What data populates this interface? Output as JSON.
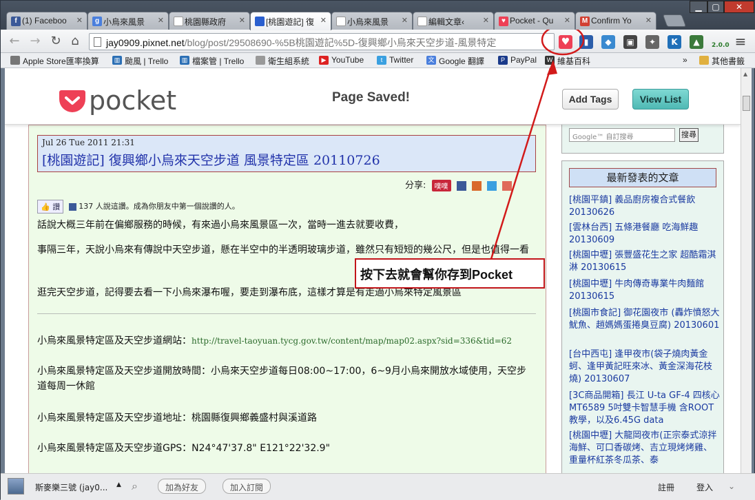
{
  "tabs": [
    {
      "label": "(1) Faceboo",
      "fav": "f",
      "favColor": "#3b5998"
    },
    {
      "label": "小烏來風景",
      "fav": "g",
      "favColor": "#4a7fdd"
    },
    {
      "label": "桃園縣政府",
      "fav": "",
      "favColor": "#ffffff"
    },
    {
      "label": "[桃園遊記] 復",
      "fav": "",
      "favColor": "#2a5fcf"
    },
    {
      "label": "小烏來風景",
      "fav": "",
      "favColor": "#ffffff"
    },
    {
      "label": "編輯文章‹",
      "fav": "",
      "favColor": "#ffffff"
    },
    {
      "label": "Pocket - Qu",
      "fav": "♥",
      "favColor": "#ee4056"
    },
    {
      "label": "Confirm Yo",
      "fav": "M",
      "favColor": "#d23f31"
    }
  ],
  "toolbar": {
    "url_host": "jay0909.pixnet.net",
    "url_path": "/blog/post/29508690-%5B桃園遊記%5D-復興鄉小烏來天空步道-風景特定",
    "extension_badge": "2.0.0"
  },
  "bookmarks": [
    {
      "label": "Apple Store匯率換算",
      "color": "#777"
    },
    {
      "label": "颱風 | Trello",
      "color": "#2b6fb5"
    },
    {
      "label": "檔案管 | Trello",
      "color": "#2b6fb5"
    },
    {
      "label": "衛生組系統",
      "color": "#999"
    },
    {
      "label": "YouTube",
      "color": "#d22"
    },
    {
      "label": "Twitter",
      "color": "#3aa0e0"
    },
    {
      "label": "Google 翻譯",
      "color": "#4a7fdd"
    },
    {
      "label": "PayPal",
      "color": "#1a3a8a"
    },
    {
      "label": "維基百科",
      "color": "#333"
    }
  ],
  "bookmarks_overflow": "»",
  "other_bookmarks": "其他書籤",
  "pocket": {
    "logo_text": "pocket",
    "saved": "Page Saved!",
    "add_tags": "Add Tags",
    "view_list": "View List"
  },
  "post": {
    "date": "Jul 26 Tue 2011 21:31",
    "title": "[桃園遊記] 復興鄉小烏來天空步道 風景特定區 20110726",
    "share_label": "分享:",
    "share_plurk": "噗噗",
    "like_btn": "讚",
    "like_text": "137 人說這讚。成為你朋友中第一個說讚的人。",
    "p1": "話說大概三年前在偏鄉服務的時候，有來過小烏來風景區一次，當時一進去就要收費，",
    "p2": "事隔三年，天說小烏來有傳說中天空步道，懸在半空中的半透明玻璃步道，雖然只有短短的幾公尺，但是也值得一看",
    "p3": "逛完天空步道，記得要去看一下小烏來瀑布喔，要走到瀑布底，這樣才算是有走過小烏來特定風景區",
    "site_label": "小烏來風景特定區及天空步道網站：",
    "site_url": "http://travel-taoyuan.tycg.gov.tw/content/map/map02.aspx?sid=336&tid=62",
    "hours": "小烏來風景特定區及天空步道開放時間：小烏來天空步道每日08:00~17:00，6~9月小烏來開放水域使用，天空步道每周一休館",
    "address": "小烏來風景特定區及天空步道地址：桃園縣復興鄉義盛村與溪道路",
    "gps": "小烏來風景特定區及天空步道GPS：N24°47'37.8\" E121°22'32.9\""
  },
  "sidebar": {
    "search_placeholder": "自訂搜尋",
    "search_google": "Google™",
    "search_button": "搜尋",
    "recent_title": "最新發表的文章",
    "recent": [
      "[桃園平鎮] 義品廚房複合式餐飲 20130626",
      "[雲林台西] 五條港餐廳 吃海鮮趣 20130609",
      "[桃園中壢] 張豐盛花生之家 超酷霜淇淋 20130615",
      "[桃園中壢] 牛肉傳奇專業牛肉麵館 20130615",
      "[桃園市食記] 御花園夜市 (轟炸憤怒大魷魚、趙媽媽蛋捲臭豆腐) 20130601",
      "[台中西屯] 逢甲夜市(袋子燒肉黃金蚵、逢甲黃記旺來冰、黃金深海花枝燒) 20130607",
      "[3C商品開箱] 長江 U-ta GF-4 四核心 MT6589 5吋雙卡智慧手機 含ROOT教學，以及6.45G data",
      "[桃園中壢] 大龍岡夜市(正宗泰式涼拌海鮮、可口香碳烤、吉立現烤烤雞、重量杯紅茶冬瓜茶、泰"
    ]
  },
  "callout": "按下去就會幫你存到Pocket",
  "status": {
    "user": "斯麥樂三號 (jay0...",
    "add_friend": "加為好友",
    "subscribe": "加入訂閱",
    "register": "註冊",
    "login": "登入"
  }
}
